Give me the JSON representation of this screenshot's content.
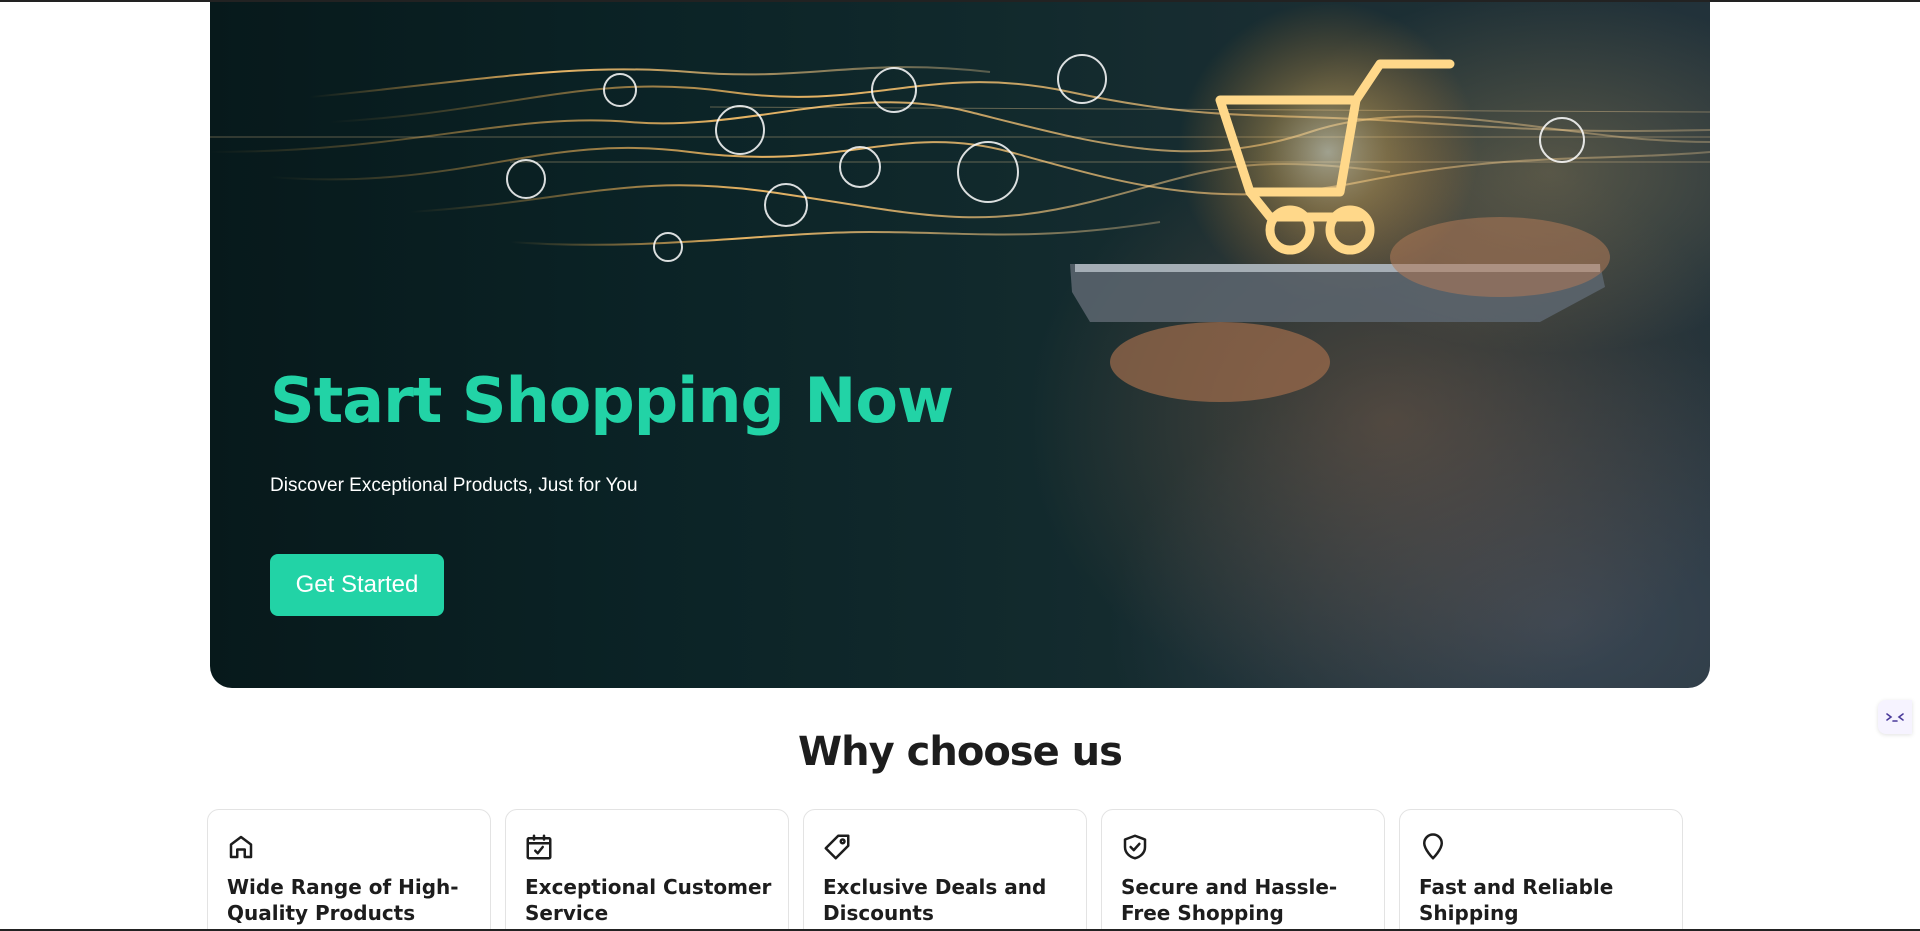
{
  "hero": {
    "title": "Start Shopping Now",
    "subtitle": "Discover Exceptional Products, Just for You",
    "cta_label": "Get Started"
  },
  "why": {
    "title": "Why choose us",
    "cards": [
      {
        "icon": "home-icon",
        "title": "Wide Range of High-Quality Products"
      },
      {
        "icon": "calendar-check-icon",
        "title": "Exceptional Customer Service"
      },
      {
        "icon": "tag-icon",
        "title": "Exclusive Deals and Discounts"
      },
      {
        "icon": "shield-check-icon",
        "title": "Secure and Hassle-Free Shopping"
      },
      {
        "icon": "map-pin-icon",
        "title": "Fast and Reliable Shipping"
      }
    ]
  },
  "colors": {
    "accent": "#22d3a6",
    "hero_dark": "#0b2326",
    "heading_text": "#1d1d1d"
  }
}
